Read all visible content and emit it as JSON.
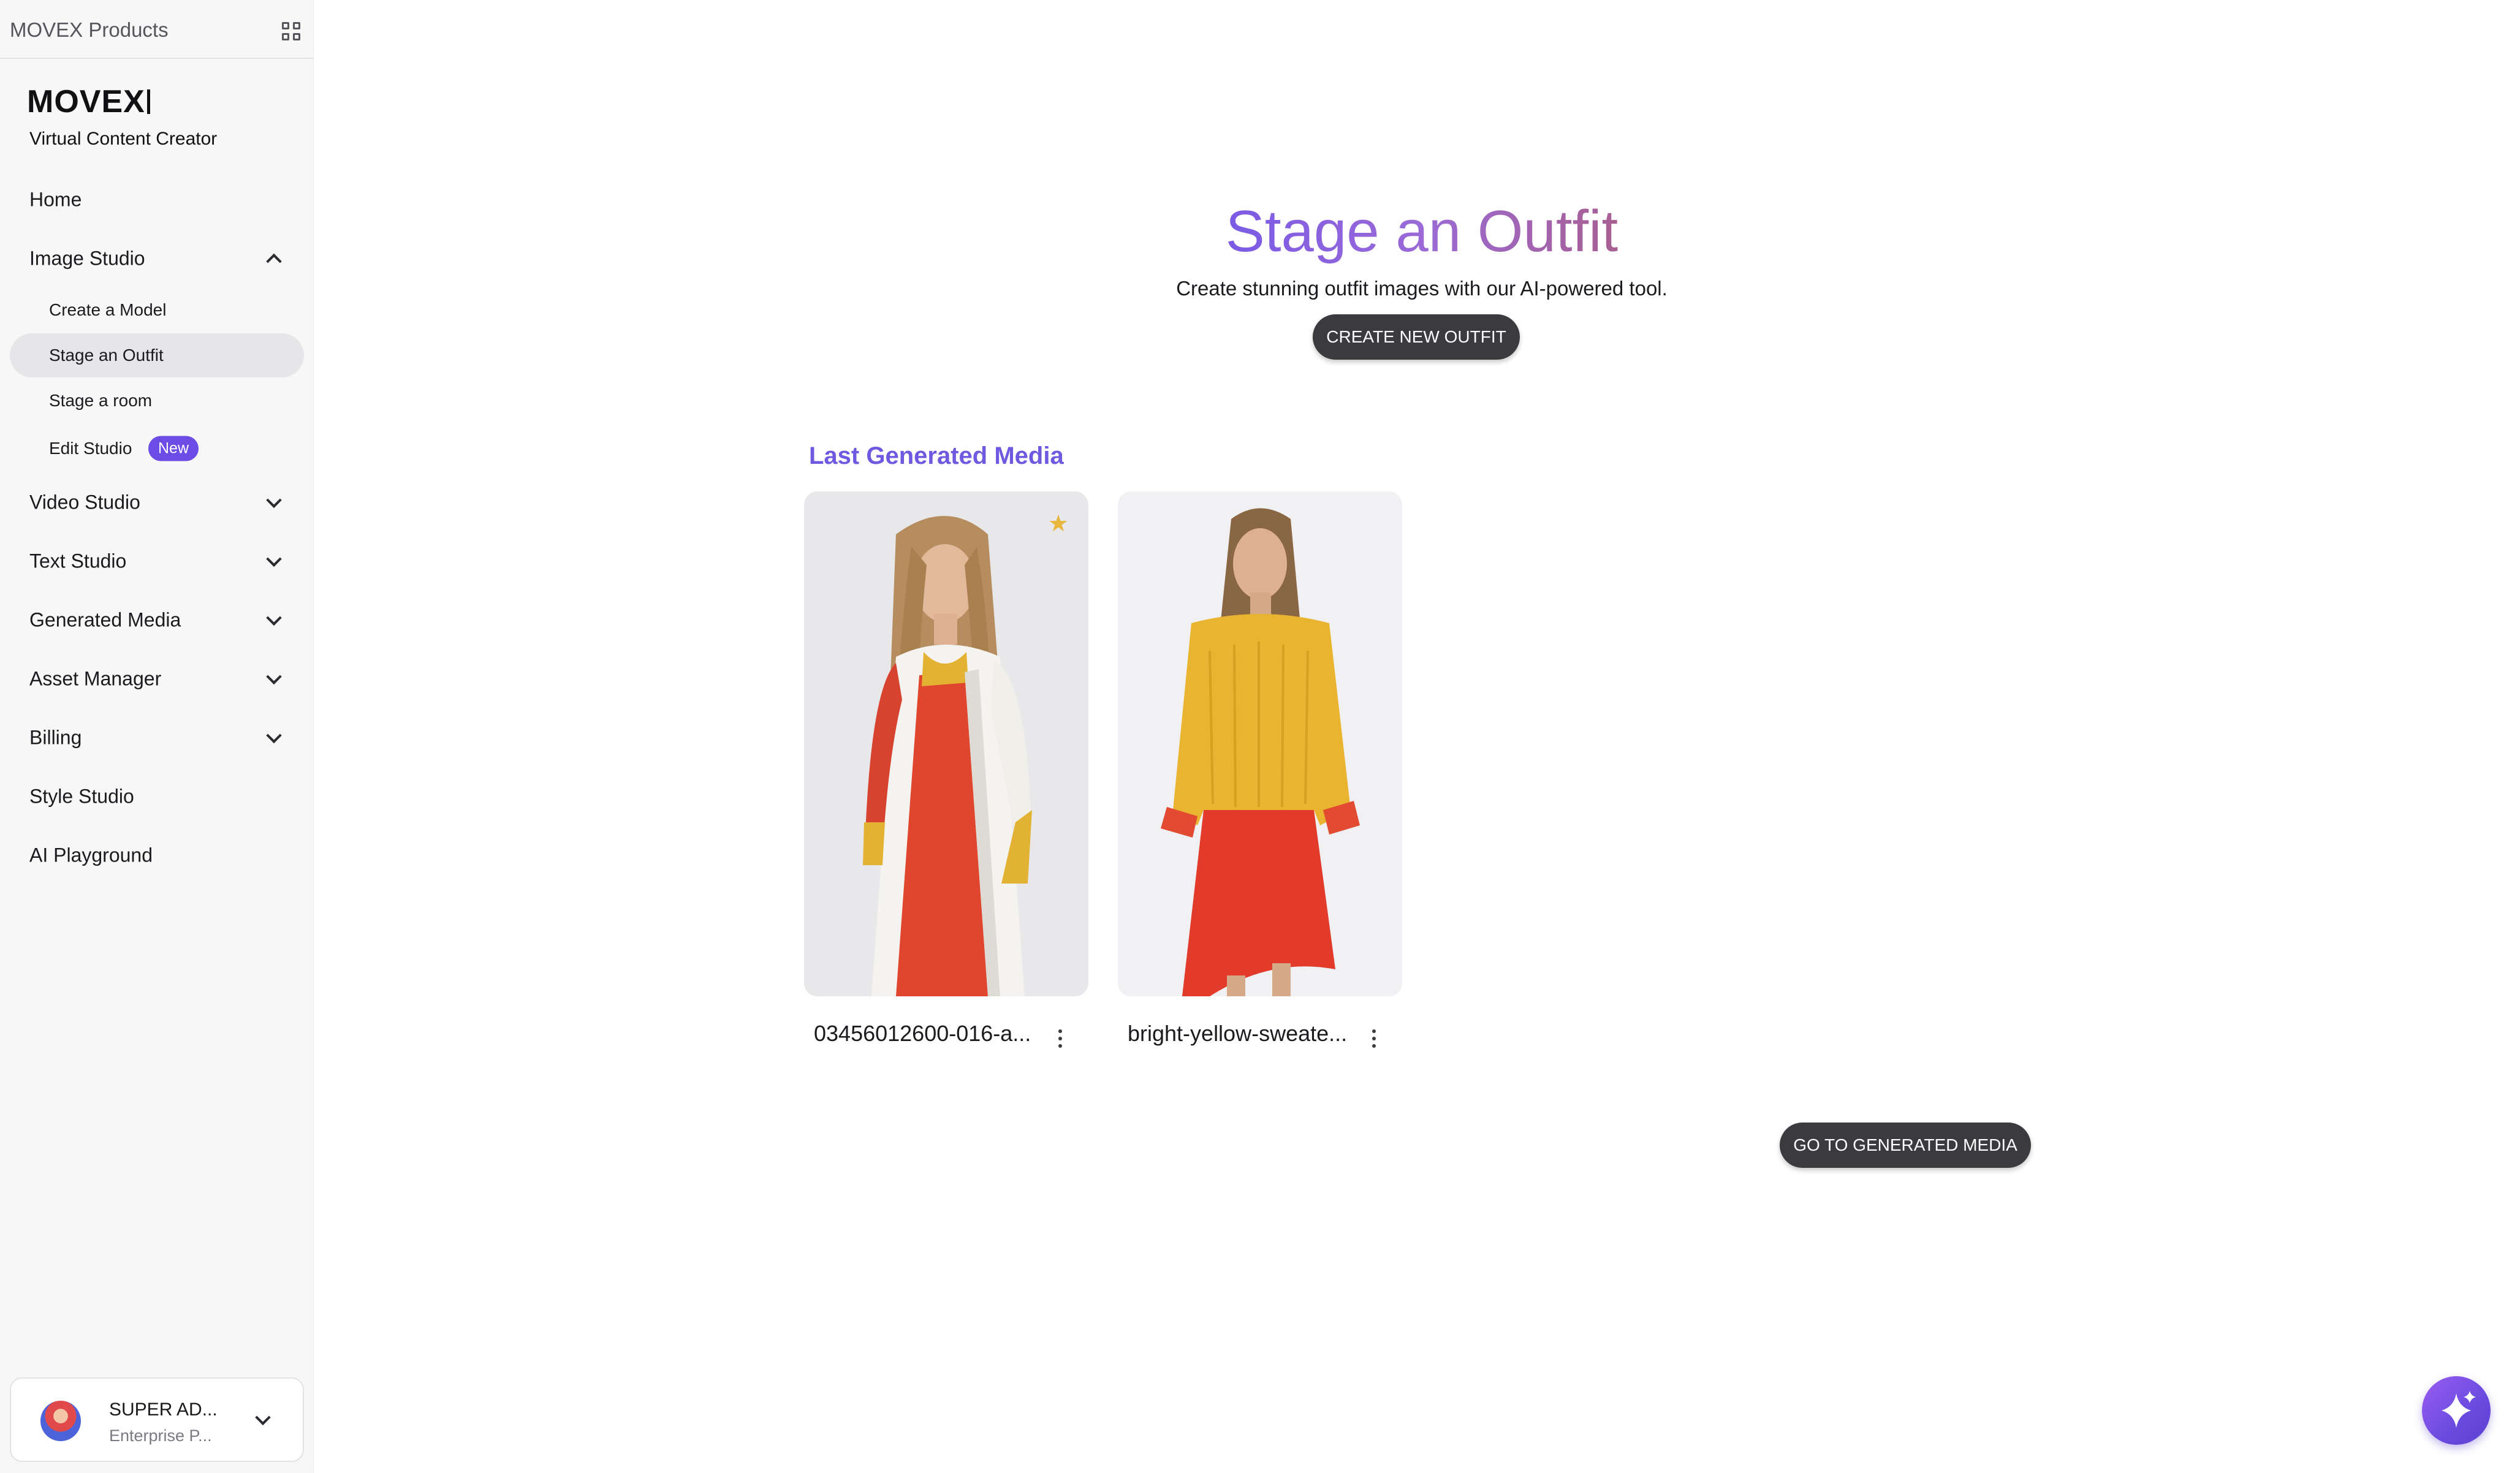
{
  "sidebar": {
    "products_label": "MOVEX Products",
    "brand": "MOVEX",
    "brand_subtitle": "Virtual Content Creator",
    "items": [
      {
        "label": "Home"
      },
      {
        "label": "Image Studio",
        "expanded": true
      },
      {
        "label": "Video Studio"
      },
      {
        "label": "Text Studio"
      },
      {
        "label": "Generated Media"
      },
      {
        "label": "Asset Manager"
      },
      {
        "label": "Billing"
      },
      {
        "label": "Style Studio"
      },
      {
        "label": "AI Playground"
      }
    ],
    "image_studio_subitems": [
      {
        "label": "Create a Model"
      },
      {
        "label": "Stage an Outfit",
        "active": true
      },
      {
        "label": "Stage a room"
      },
      {
        "label": "Edit Studio",
        "badge": "New"
      }
    ],
    "user": {
      "name": "SUPER AD...",
      "plan": "Enterprise P..."
    }
  },
  "main": {
    "title": "Stage an Outfit",
    "subtitle": "Create stunning outfit images with our AI-powered tool.",
    "create_button": "CREATE NEW OUTFIT",
    "section_title": "Last Generated Media",
    "media": [
      {
        "caption": "03456012600-016-a...",
        "favorite": true
      },
      {
        "caption": "bright-yellow-sweate...",
        "favorite": false
      }
    ],
    "goto_button": "GO TO GENERATED MEDIA"
  },
  "colors": {
    "accent": "#6b4de6",
    "section_title": "#7058e0",
    "button_dark": "#3b3b3f",
    "sidebar_bg": "#f7f7f8",
    "favorite_star": "#e8b63c"
  },
  "icons": [
    "grid-icon",
    "chevron-up-icon",
    "chevron-down-icon",
    "star-icon",
    "more-vertical-icon",
    "sparkle-icon",
    "avatar"
  ]
}
